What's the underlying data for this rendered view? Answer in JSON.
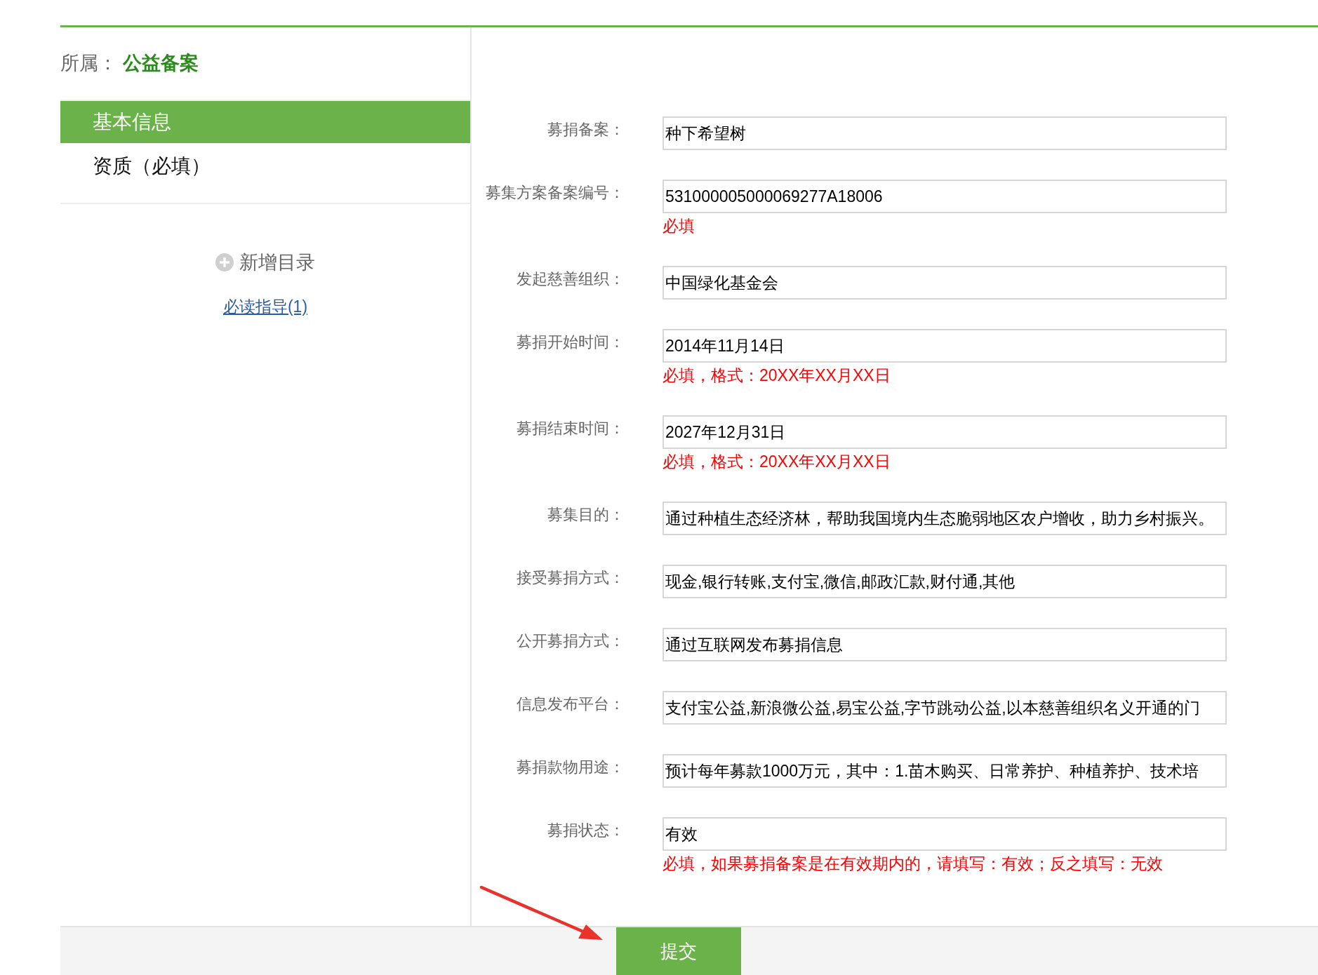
{
  "breadcrumb": {
    "label": "所属：",
    "value": "公益备案"
  },
  "sidebar": {
    "items": [
      {
        "label": "基本信息",
        "selected": true
      },
      {
        "label": "资质（必填）",
        "selected": false
      }
    ],
    "add_button": "新增目录",
    "guide_link": "必读指导(1)"
  },
  "form": {
    "fields": [
      {
        "label": "募捐备案：",
        "value": "种下希望树"
      },
      {
        "label": "募集方案备案编号：",
        "value": "531000005000069277A18006",
        "hint": "必填"
      },
      {
        "label": "发起慈善组织：",
        "value": "中国绿化基金会"
      },
      {
        "label": "募捐开始时间：",
        "value": "2014年11月14日",
        "hint": "必填，格式：20XX年XX月XX日"
      },
      {
        "label": "募捐结束时间：",
        "value": "2027年12月31日",
        "hint": "必填，格式：20XX年XX月XX日"
      },
      {
        "label": "募集目的：",
        "value": "通过种植生态经济林，帮助我国境内生态脆弱地区农户增收，助力乡村振兴。"
      },
      {
        "label": "接受募捐方式：",
        "value": "现金,银行转账,支付宝,微信,邮政汇款,财付通,其他"
      },
      {
        "label": "公开募捐方式：",
        "value": "通过互联网发布募捐信息"
      },
      {
        "label": "信息发布平台：",
        "value": "支付宝公益,新浪微公益,易宝公益,字节跳动公益,以本慈善组织名义开通的门"
      },
      {
        "label": "募捐款物用途：",
        "value": "预计每年募款1000万元，其中：1.苗木购买、日常养护、种植养护、技术培"
      },
      {
        "label": "募捐状态：",
        "value": "有效",
        "hint": "必填，如果募捐备案是在有效期内的，请填写：有效；反之填写：无效"
      }
    ]
  },
  "submit_button": "提交"
}
